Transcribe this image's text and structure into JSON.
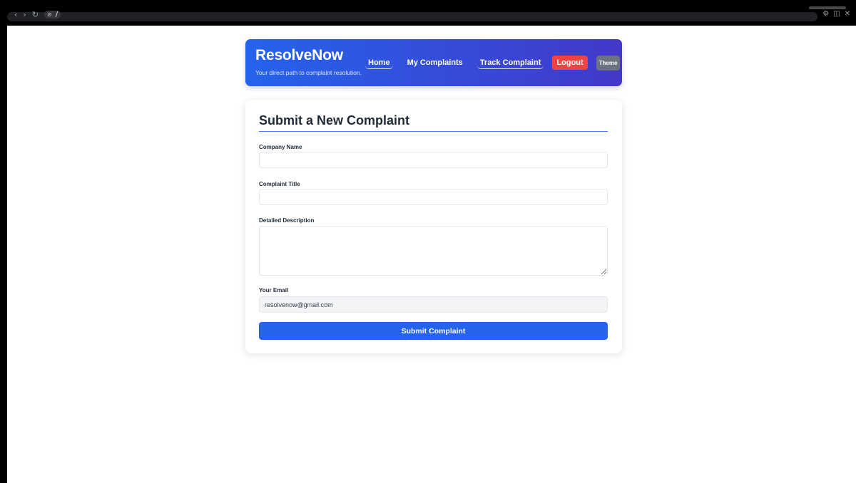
{
  "browser": {
    "url_path": "/",
    "site_info_icon": "eye-slash-icon",
    "icons": [
      "back-icon",
      "forward-icon",
      "reload-icon",
      "extensions-icon",
      "sidepanel-icon",
      "close-icon"
    ]
  },
  "header": {
    "brand": "ResolveNow",
    "tagline": "Your direct path to complaint resolution.",
    "nav": {
      "home": "Home",
      "my_complaints": "My Complaints",
      "track_complaint": "Track Complaint",
      "logout": "Logout",
      "theme": "Theme"
    },
    "gradient_start": "#2563eb",
    "gradient_end": "#4338ca"
  },
  "form": {
    "title": "Submit a New Complaint",
    "fields": {
      "company_name": {
        "label": "Company Name",
        "value": "",
        "placeholder": ""
      },
      "complaint_title": {
        "label": "Complaint Title",
        "value": "",
        "placeholder": ""
      },
      "description": {
        "label": "Detailed Description",
        "value": "",
        "placeholder": ""
      },
      "email": {
        "label": "Your Email",
        "value": "resolvenow@gmail.com",
        "readonly": true
      }
    },
    "submit_label": "Submit Complaint"
  },
  "colors": {
    "accent": "#2563eb",
    "logout": "#ef4444",
    "theme_button": "#6b7280",
    "heading_text": "#1f2937"
  }
}
